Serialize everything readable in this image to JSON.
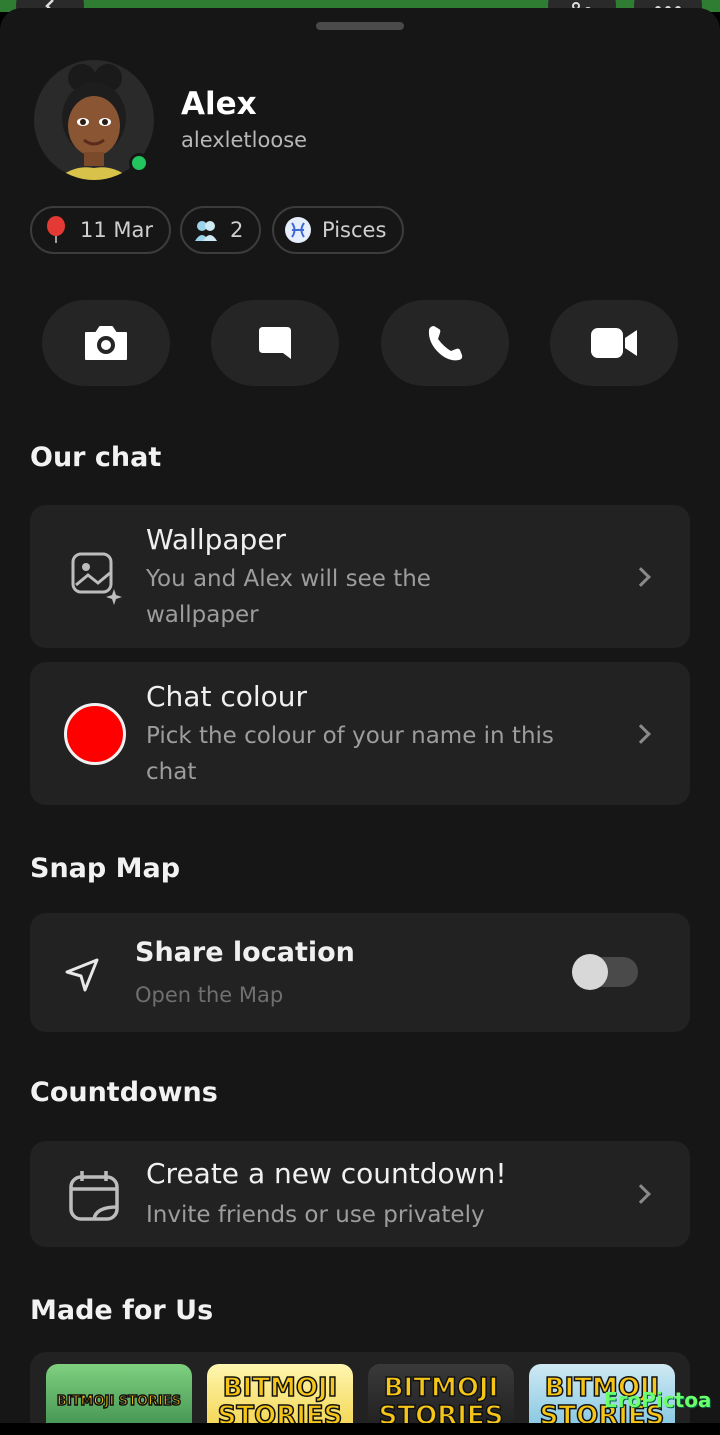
{
  "profile": {
    "name": "Alex",
    "username": "alexletloose"
  },
  "chips": [
    {
      "icon": "balloon-icon",
      "label": "11 Mar"
    },
    {
      "icon": "friends-icon",
      "label": "2"
    },
    {
      "icon": "pisces-icon",
      "label": "Pisces"
    }
  ],
  "actions": [
    "camera-icon",
    "chat-icon",
    "phone-icon",
    "video-icon"
  ],
  "our_chat": {
    "title": "Our chat",
    "wallpaper": {
      "title": "Wallpaper",
      "sub1": "You and Alex will see the",
      "sub2": "wallpaper"
    },
    "chat_colour": {
      "title": "Chat colour",
      "sub1": "Pick the colour of your name in this",
      "sub2": "chat",
      "color": "#ff0000"
    }
  },
  "snap_map": {
    "title": "Snap Map",
    "share_location": {
      "title": "Share location",
      "sub": "Open the Map",
      "enabled": false
    }
  },
  "countdowns": {
    "title": "Countdowns",
    "create": {
      "title": "Create a new countdown!",
      "sub": "Invite friends or use privately"
    }
  },
  "made_for_us": {
    "title": "Made for Us",
    "items": [
      {
        "label": "BITMOJI STORIES"
      },
      {
        "label": "BITMOJI STORIES"
      },
      {
        "label": "BITMOJI STORIES"
      },
      {
        "label": "BITMOJI STORIES"
      }
    ]
  },
  "watermark": "EroPictoa",
  "colors": {
    "sheet": "#161616",
    "card": "#222222",
    "online": "#22c55e"
  }
}
